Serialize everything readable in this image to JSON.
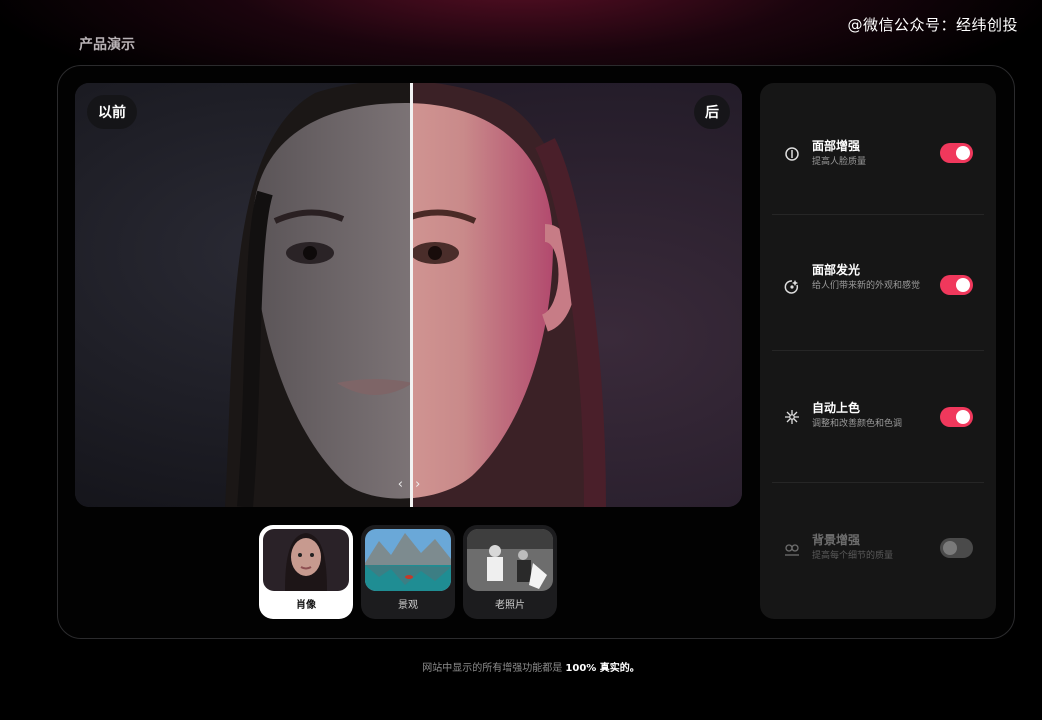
{
  "watermark": "@微信公众号：经纬创投",
  "section_title": "产品演示",
  "compare": {
    "before_label": "以前",
    "after_label": "后",
    "handle": "‹ ›"
  },
  "thumbnails": [
    {
      "label": "肖像",
      "active": true
    },
    {
      "label": "景观",
      "active": false
    },
    {
      "label": "老照片",
      "active": false
    }
  ],
  "features": [
    {
      "name": "面部增强",
      "desc": "提高人脸质量",
      "enabled": true,
      "icon": "face-enhance-icon"
    },
    {
      "name": "面部发光",
      "desc": "给人们带来新的外观和感觉",
      "enabled": true,
      "icon": "face-glow-icon"
    },
    {
      "name": "自动上色",
      "desc": "调整和改善颜色和色调",
      "enabled": true,
      "icon": "sparkle-icon"
    },
    {
      "name": "背景增强",
      "desc": "提高每个细节的质量",
      "enabled": false,
      "icon": "background-enhance-icon"
    }
  ],
  "footer": {
    "prefix": "网站中显示的所有增强功能都是 ",
    "highlight": "100% 真实的。"
  },
  "colors": {
    "accent": "#f0385c",
    "panel": "#161616"
  }
}
